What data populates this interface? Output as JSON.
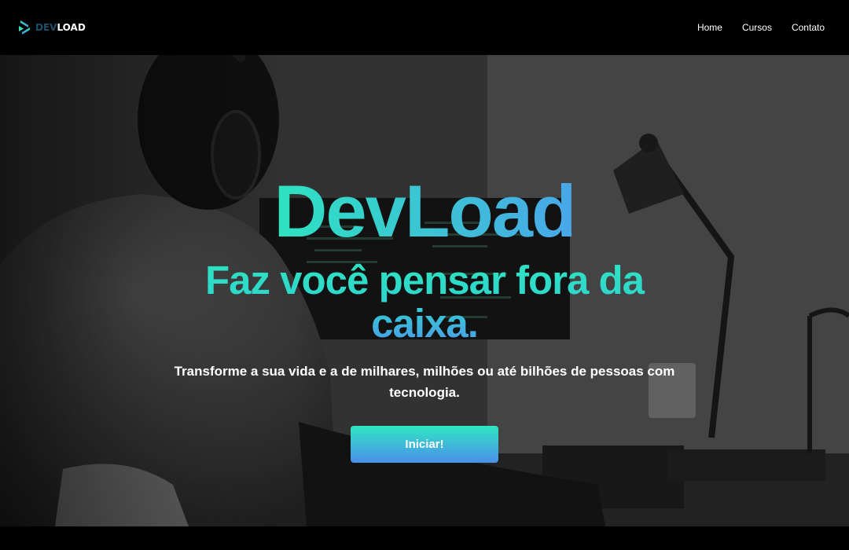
{
  "brand": {
    "logo_prefix": "DEV",
    "logo_suffix": "LOAD",
    "icon": "devload-logo-icon"
  },
  "nav": {
    "items": [
      {
        "label": "Home"
      },
      {
        "label": "Cursos"
      },
      {
        "label": "Contato"
      }
    ]
  },
  "hero": {
    "title": "DevLoad",
    "subtitle": "Faz você pensar fora da caixa.",
    "description": "Transforme a sua vida e a de milhares, milhões ou até bilhões de pessoas com tecnologia.",
    "cta_label": "Iniciar!"
  },
  "colors": {
    "accent_green": "#2de3c0",
    "accent_blue": "#49a7e8",
    "nav_background": "#000000",
    "text": "#ffffff"
  }
}
